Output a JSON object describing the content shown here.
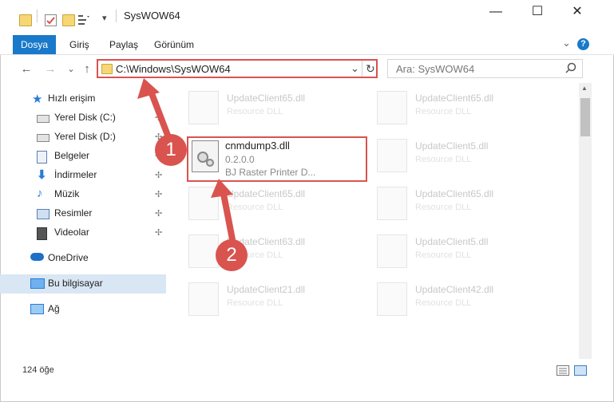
{
  "window": {
    "title": "SysWOW64",
    "minimize_glyph": "—",
    "maximize_glyph": "☐",
    "close_glyph": "✕"
  },
  "ribbon": {
    "tabs": [
      "Dosya",
      "Giriş",
      "Paylaş",
      "Görünüm"
    ],
    "expand_glyph": "⌄",
    "help_glyph": "?"
  },
  "address": {
    "back_glyph": "←",
    "forward_glyph": "→",
    "recent_glyph": "⌄",
    "up_glyph": "↑",
    "path": "C:\\Windows\\SysWOW64",
    "dropdown_glyph": "⌄",
    "refresh_glyph": "↻"
  },
  "search": {
    "placeholder": "Ara: SysWOW64"
  },
  "nav": {
    "items": [
      {
        "label": "Hızlı erişim",
        "icon": "star-icon",
        "color": "#2a7bd8"
      },
      {
        "label": "Yerel Disk (C:)",
        "icon": "drive-icon",
        "color": "#6a6a6a"
      },
      {
        "label": "Yerel Disk (D:)",
        "icon": "drive-icon",
        "color": "#6a6a6a"
      },
      {
        "label": "Belgeler",
        "icon": "documents-icon",
        "color": "#5a7fb0"
      },
      {
        "label": "İndirmeler",
        "icon": "downloads-icon",
        "color": "#2a7bd8"
      },
      {
        "label": "Müzik",
        "icon": "music-icon",
        "color": "#2a7bd8"
      },
      {
        "label": "Resimler",
        "icon": "pictures-icon",
        "color": "#5a7fb0"
      },
      {
        "label": "Videolar",
        "icon": "videos-icon",
        "color": "#444"
      },
      {
        "label": "OneDrive",
        "icon": "cloud-icon",
        "color": "#1f6fc5"
      },
      {
        "label": "Bu bilgisayar",
        "icon": "computer-icon",
        "color": "#2a7bd8"
      },
      {
        "label": "Ağ",
        "icon": "network-icon",
        "color": "#2a7bd8"
      }
    ],
    "pin_glyph": "📌"
  },
  "files": {
    "left_column": [
      {
        "name": "UpdateClient65.dll",
        "desc": "Resource DLL"
      },
      {
        "name": "UpdateClient65.dll",
        "desc": "Resource DLL"
      },
      {
        "name": "UpdateClient63.dll",
        "desc": "Resource DLL"
      },
      {
        "name": "UpdateClient21.dll",
        "desc": "Resource DLL"
      }
    ],
    "right_column": [
      {
        "name": "UpdateClient65.dll",
        "desc": "Resource DLL"
      },
      {
        "name": "UpdateClient5.dll",
        "desc": "Resource DLL"
      },
      {
        "name": "UpdateClient65.dll",
        "desc": "Resource DLL"
      },
      {
        "name": "UpdateClient5.dll",
        "desc": "Resource DLL"
      },
      {
        "name": "UpdateClient42.dll",
        "desc": "Resource DLL"
      }
    ],
    "highlighted": {
      "name": "cnmdump3.dll",
      "version": "0.2.0.0",
      "desc": "BJ Raster Printer D..."
    }
  },
  "annotations": {
    "step1": "1",
    "step2": "2"
  },
  "status": {
    "count": "124 öğe"
  },
  "colors": {
    "accent": "#1979ca",
    "annotation": "#d9534f"
  }
}
